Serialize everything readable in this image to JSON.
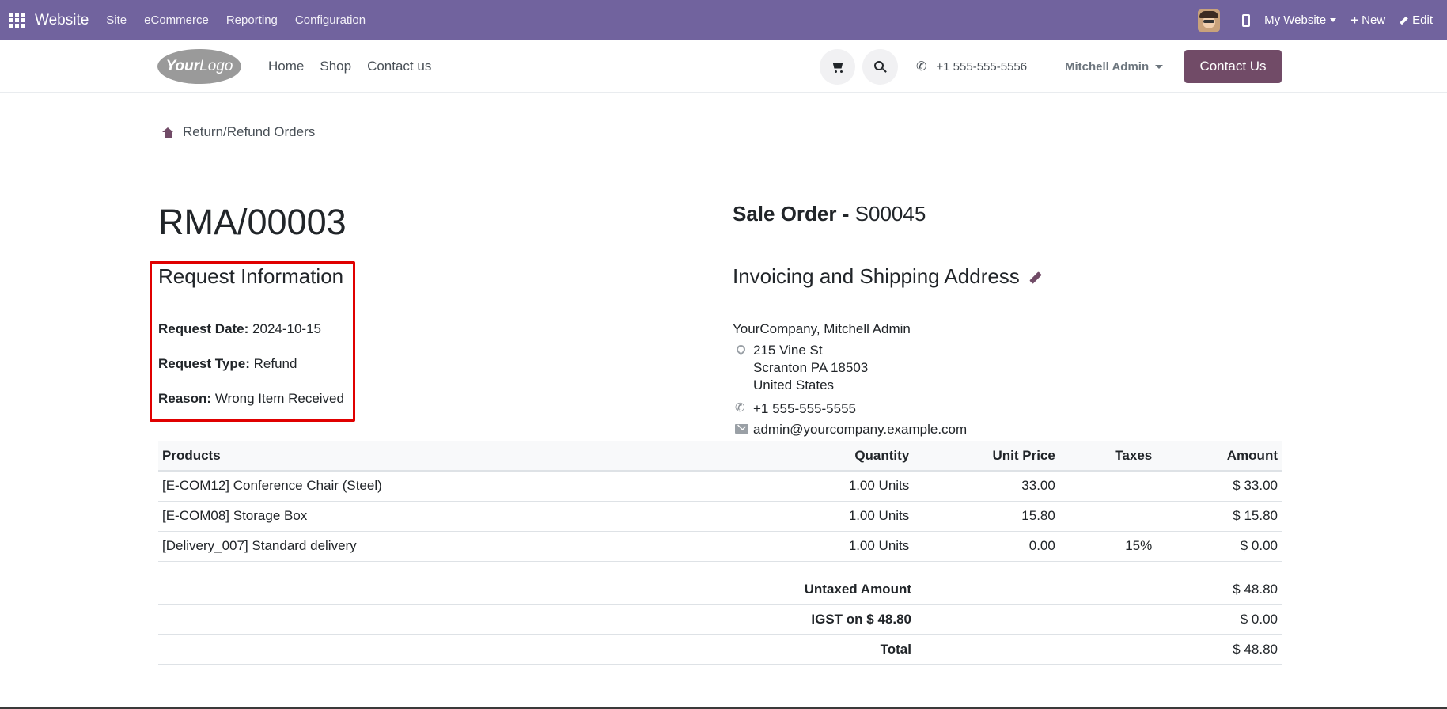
{
  "admin_bar": {
    "brand": "Website",
    "menus": [
      "Site",
      "eCommerce",
      "Reporting",
      "Configuration"
    ],
    "my_website": "My Website",
    "new": "New",
    "edit": "Edit"
  },
  "header": {
    "logo_text_bold": "Your",
    "logo_text": "Logo",
    "nav": [
      "Home",
      "Shop",
      "Contact us"
    ],
    "phone": "+1 555-555-5556",
    "user": "Mitchell Admin",
    "contact_button": "Contact Us"
  },
  "breadcrumb": "Return/Refund Orders",
  "rma": {
    "title": "RMA/00003",
    "section_title": "Request Information",
    "request_date_label": "Request Date:",
    "request_date": "2024-10-15",
    "request_type_label": "Request Type:",
    "request_type": "Refund",
    "reason_label": "Reason:",
    "reason": "Wrong Item Received"
  },
  "sale_order": {
    "label": "Sale Order -",
    "number": "S00045",
    "address_title": "Invoicing and Shipping Address",
    "name": "YourCompany, Mitchell Admin",
    "street": "215 Vine St",
    "city": "Scranton PA 18503",
    "country": "United States",
    "phone": "+1 555-555-5555",
    "email": "admin@yourcompany.example.com"
  },
  "table": {
    "headers": [
      "Products",
      "Quantity",
      "Unit Price",
      "Taxes",
      "Amount"
    ],
    "rows": [
      {
        "product": "[E-COM12] Conference Chair (Steel)",
        "quantity": "1.00 Units",
        "unit_price": "33.00",
        "taxes": "",
        "amount": "$ 33.00"
      },
      {
        "product": "[E-COM08] Storage Box",
        "quantity": "1.00 Units",
        "unit_price": "15.80",
        "taxes": "",
        "amount": "$ 15.80"
      },
      {
        "product": "[Delivery_007] Standard delivery",
        "quantity": "1.00 Units",
        "unit_price": "0.00",
        "taxes": "15%",
        "amount": "$ 0.00"
      }
    ]
  },
  "totals": {
    "untaxed_label": "Untaxed Amount",
    "untaxed": "$ 48.80",
    "tax_label": "IGST on $ 48.80",
    "tax": "$ 0.00",
    "total_label": "Total",
    "total": "$ 48.80"
  },
  "colors": {
    "admin_bar": "#71639e",
    "brand_button": "#714b67",
    "highlight": "#e00000"
  }
}
